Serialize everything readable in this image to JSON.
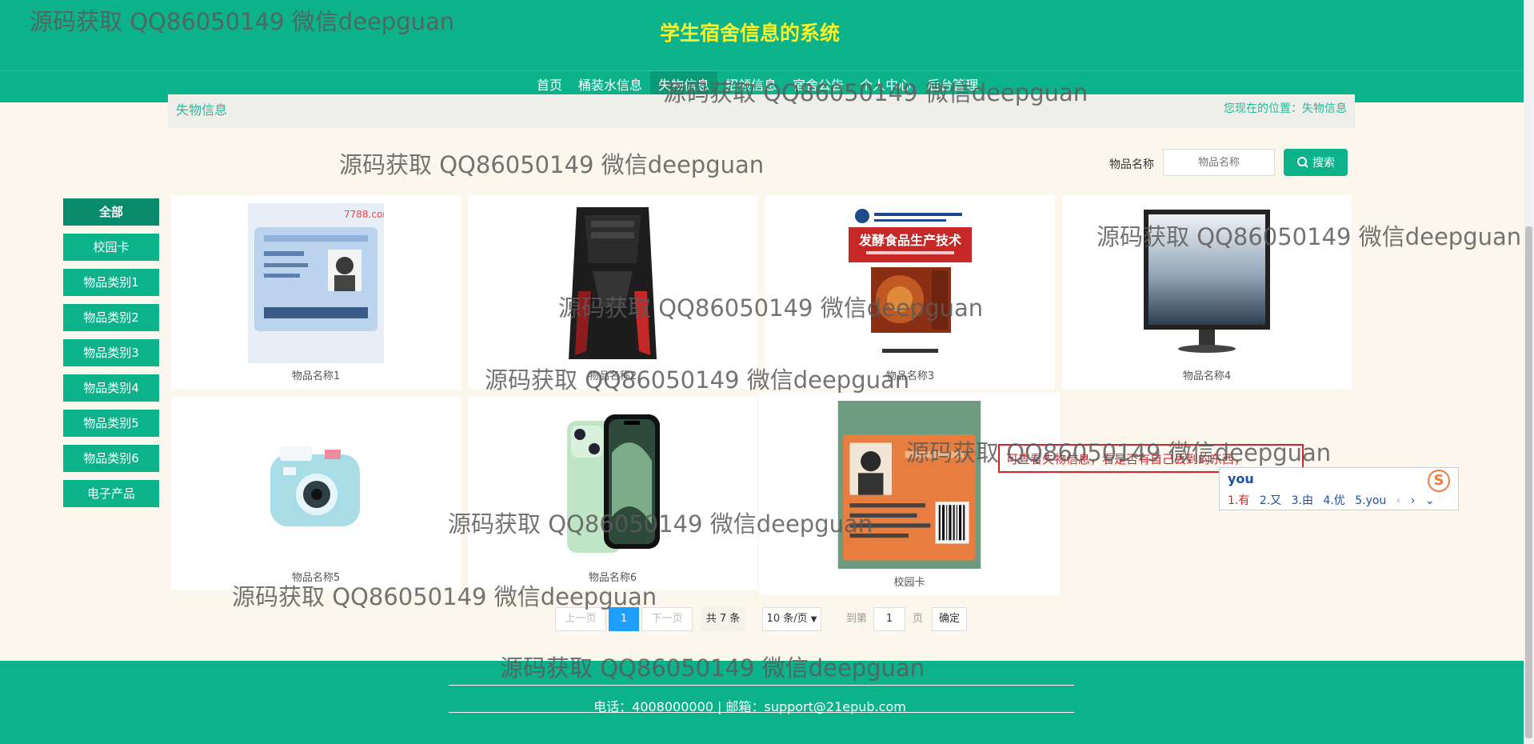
{
  "header": {
    "title": "学生宿舍信息的系统"
  },
  "nav": [
    {
      "label": "首页"
    },
    {
      "label": "桶装水信息"
    },
    {
      "label": "失物信息",
      "active": true
    },
    {
      "label": "招领信息"
    },
    {
      "label": "宿舍公告"
    },
    {
      "label": "个人中心"
    },
    {
      "label": "后台管理"
    }
  ],
  "breadcrumb": {
    "title": "失物信息",
    "location": "您现在的位置：失物信息"
  },
  "search": {
    "label": "物品名称",
    "placeholder": "物品名称",
    "button": "搜索"
  },
  "sidebar": [
    {
      "label": "全部",
      "active": true
    },
    {
      "label": "校园卡"
    },
    {
      "label": "物品类别1"
    },
    {
      "label": "物品类别2"
    },
    {
      "label": "物品类别3"
    },
    {
      "label": "物品类别4"
    },
    {
      "label": "物品类别5"
    },
    {
      "label": "物品类别6"
    },
    {
      "label": "电子产品"
    }
  ],
  "items": [
    {
      "name": "物品名称1",
      "image": "id-card-photo"
    },
    {
      "name": "物品名称2",
      "image": "pc-tower"
    },
    {
      "name": "物品名称3",
      "image": "book-cover"
    },
    {
      "name": "物品名称4",
      "image": "monitor"
    },
    {
      "name": "物品名称5",
      "image": "instant-camera"
    },
    {
      "name": "物品名称6",
      "image": "smartphone"
    },
    {
      "name": "校园卡",
      "image": "campus-card"
    }
  ],
  "book_cover_title": "发酵食品生产技术",
  "pagination": {
    "prev": "上一页",
    "current": "1",
    "next": "下一页",
    "total": "共 7 条",
    "page_size": "10 条/页",
    "goto": "到第",
    "goto_value": "1",
    "page_unit": "页",
    "confirm": "确定"
  },
  "footer": {
    "contact": "电话：4008000000 | 邮箱：support@21epub.com"
  },
  "annotation": "可查看失物信息，看是否有自己丢到的东西，",
  "ime": {
    "input": "you",
    "candidates": [
      "1.有",
      "2.又",
      "3.由",
      "4.优",
      "5.you"
    ],
    "logo": "S"
  },
  "watermark": "源码获取 QQ86050149 微信deepguan",
  "colors": {
    "primary": "#0bb28a",
    "title": "#f8f22a",
    "page_bg": "#fbf7ec"
  }
}
